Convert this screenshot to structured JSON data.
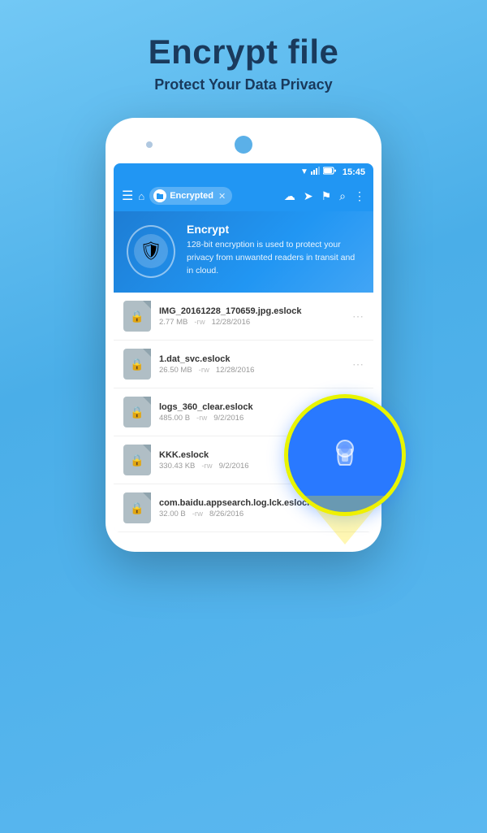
{
  "page": {
    "title": "Encrypt file",
    "subtitle": "Protect Your Data Privacy"
  },
  "status_bar": {
    "time": "15:45",
    "icons": [
      "wifi",
      "signal",
      "battery"
    ]
  },
  "app_bar": {
    "breadcrumb_label": "Encrypted",
    "actions": [
      "cloud",
      "send",
      "bookmark",
      "search",
      "more"
    ]
  },
  "banner": {
    "title": "Encrypt",
    "description": "128-bit encryption is used to protect your privacy from unwanted readers in transit and in cloud."
  },
  "files": [
    {
      "name": "IMG_20161228_170659.jpg.eslock",
      "size": "2.77 MB",
      "perm": "-rw",
      "date": "12/28/2016"
    },
    {
      "name": "1.dat_svc.eslock",
      "size": "26.50 MB",
      "perm": "-rw",
      "date": "12/28/2016"
    },
    {
      "name": "logs_360_clear.eslock",
      "size": "485.00 B",
      "perm": "-rw",
      "date": "9/2/2016"
    },
    {
      "name": "KKK.eslock",
      "size": "330.43 KB",
      "perm": "-rw",
      "date": "9/2/2016"
    },
    {
      "name": "com.baidu.appsearch.log.lck.eslock",
      "size": "32.00 B",
      "perm": "-rw",
      "date": "8/26/2016"
    }
  ]
}
